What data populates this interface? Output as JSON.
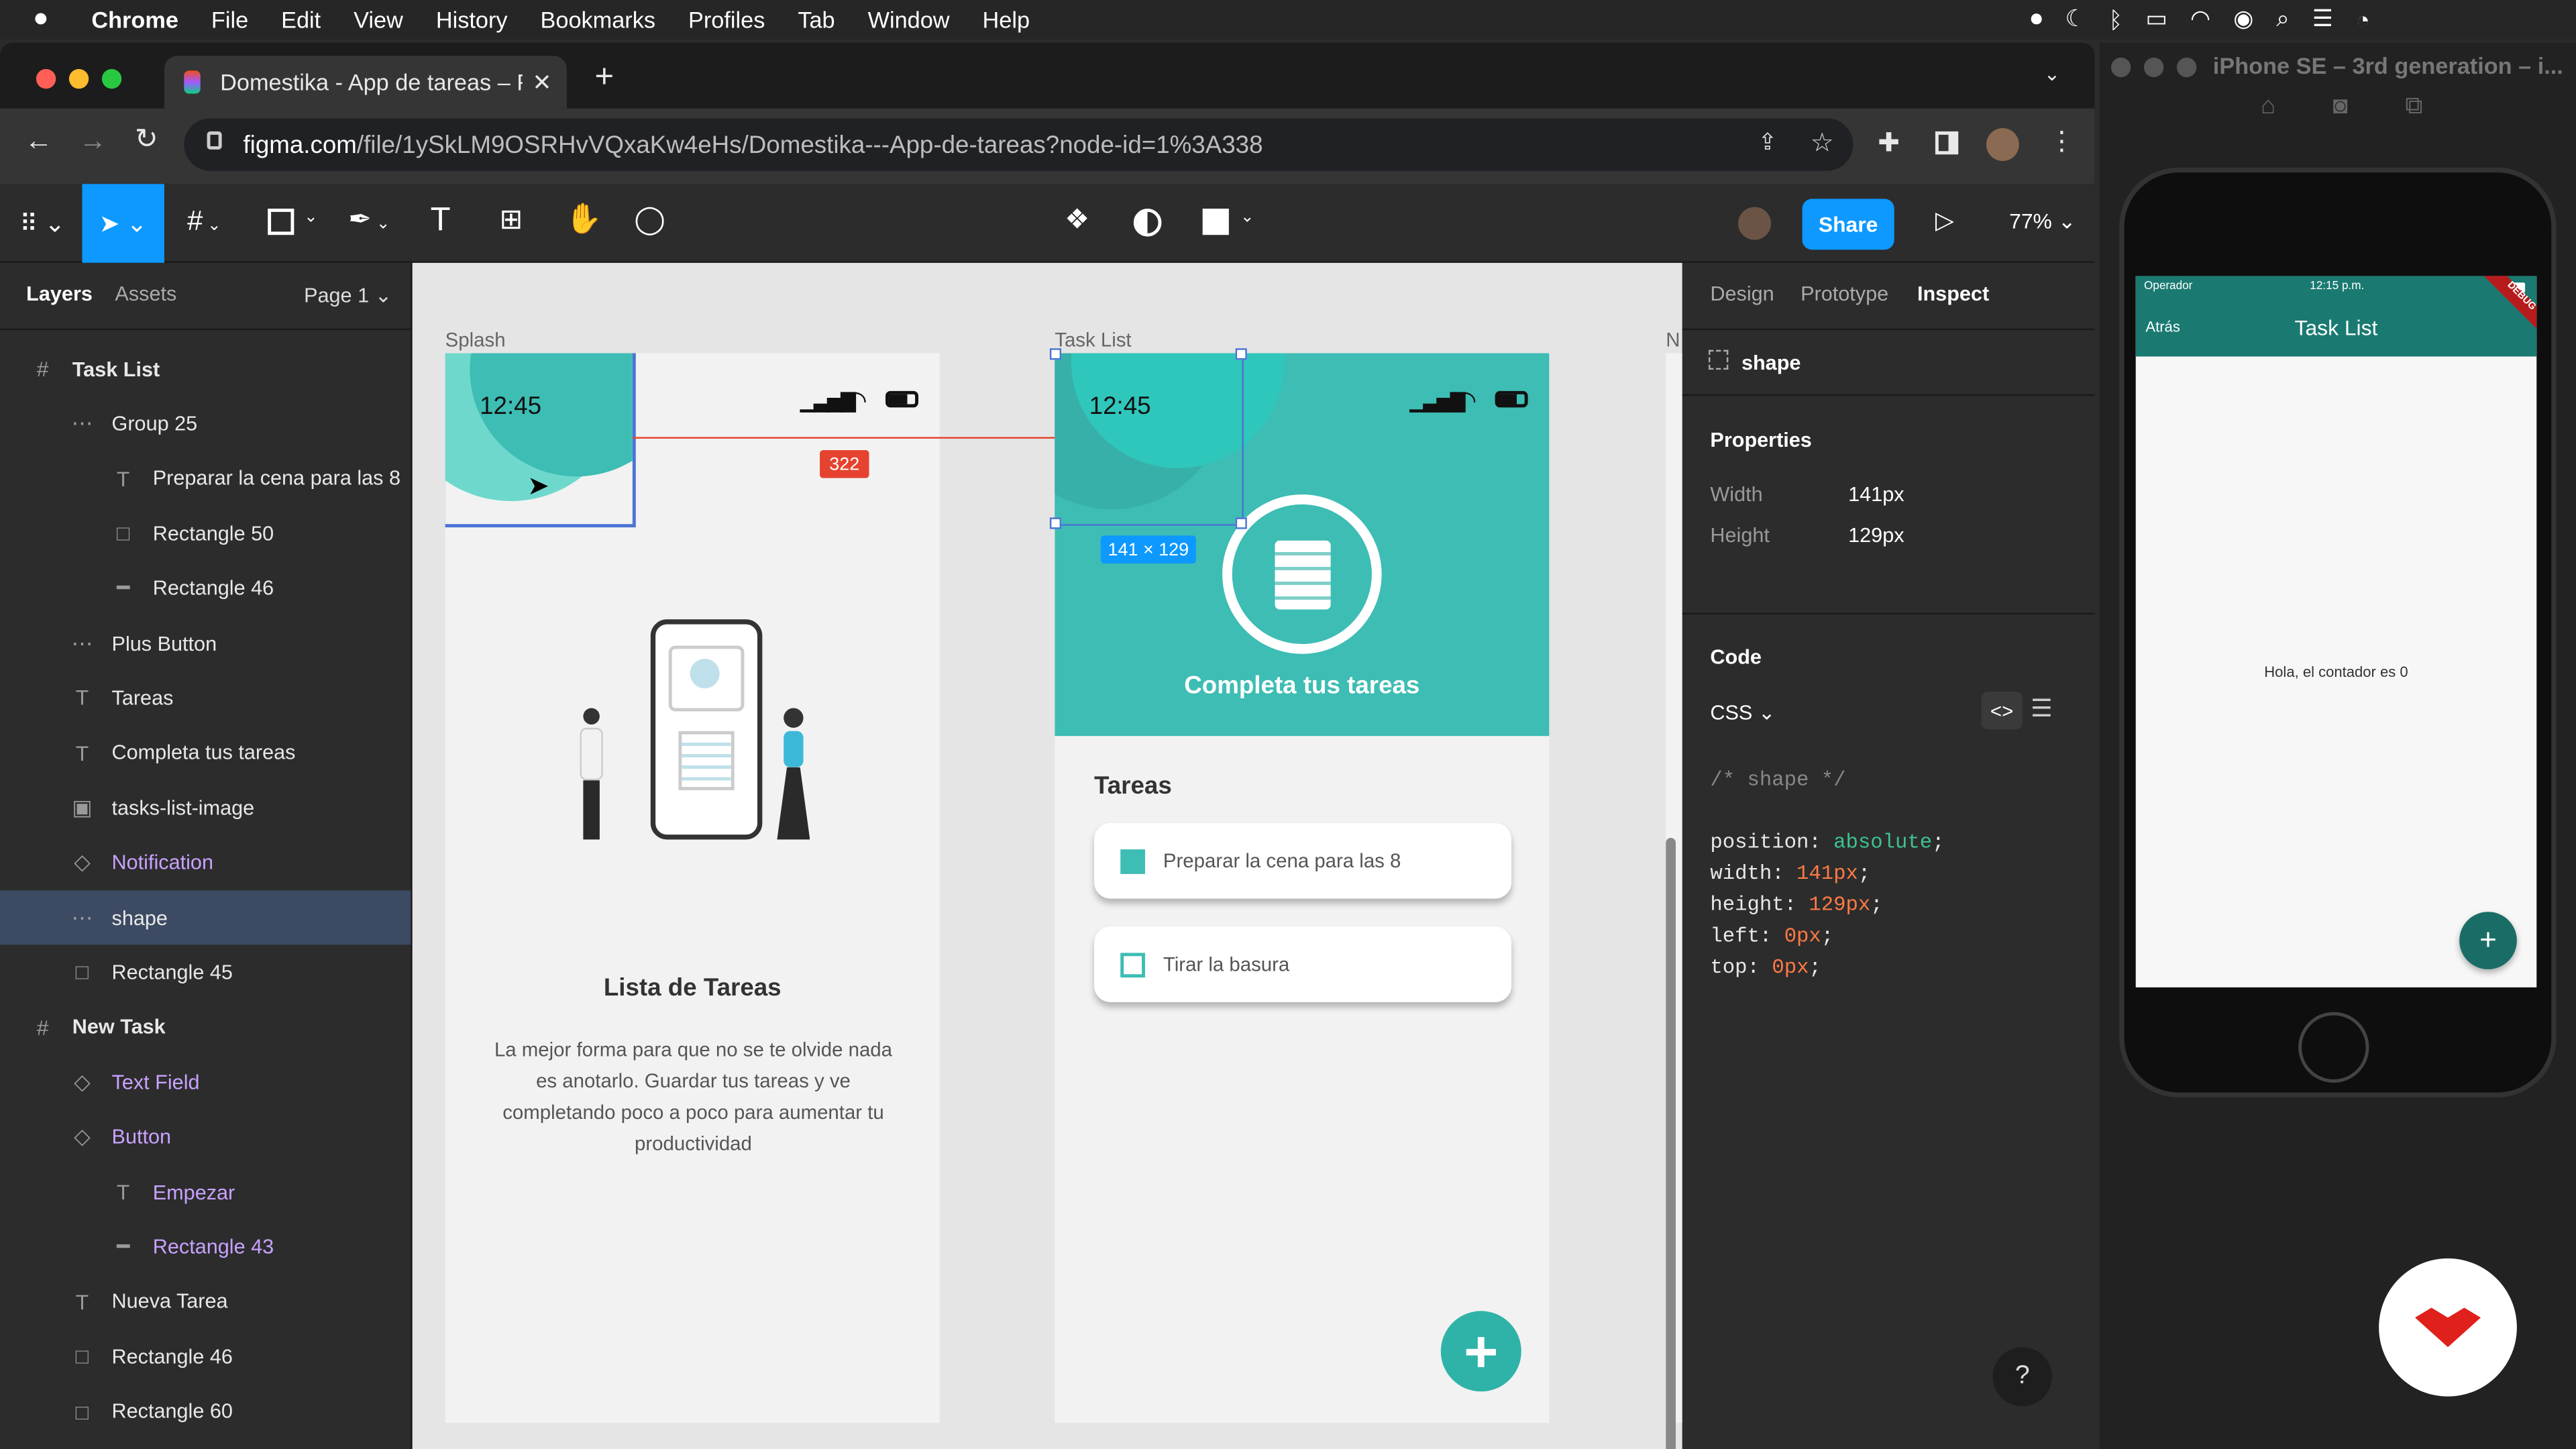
{
  "menubar": {
    "app": "Chrome",
    "items": [
      "File",
      "Edit",
      "View",
      "History",
      "Bookmarks",
      "Profiles",
      "Tab",
      "Window",
      "Help"
    ]
  },
  "browser": {
    "tab_title": "Domestika - App de tareas – Fi",
    "url_host": "figma.com",
    "url_path": "/file/1ySkLM9OSRHvVQxaKw4eHs/Domestika---App-de-tareas?node-id=1%3A338"
  },
  "figma_toolbar": {
    "share_label": "Share",
    "zoom": "77%"
  },
  "layers_panel": {
    "tabs": [
      "Layers",
      "Assets"
    ],
    "page": "Page 1",
    "items": [
      {
        "label": "Task List",
        "icon": "frame-icon"
      },
      {
        "label": "Group 25",
        "icon": "group-icon"
      },
      {
        "label": "Preparar la cena para las 8",
        "icon": "text-icon"
      },
      {
        "label": "Rectangle 50",
        "icon": "rect-icon"
      },
      {
        "label": "Rectangle 46",
        "icon": "line-icon"
      },
      {
        "label": "Plus Button",
        "icon": "group-icon"
      },
      {
        "label": "Tareas",
        "icon": "text-icon"
      },
      {
        "label": "Completa tus tareas",
        "icon": "text-icon"
      },
      {
        "label": "tasks-list-image",
        "icon": "image-icon"
      },
      {
        "label": "Notification",
        "icon": "component-icon"
      },
      {
        "label": "shape",
        "icon": "group-icon"
      },
      {
        "label": "Rectangle 45",
        "icon": "rect-icon"
      },
      {
        "label": "New Task",
        "icon": "frame-icon"
      },
      {
        "label": "Text Field",
        "icon": "component-icon"
      },
      {
        "label": "Button",
        "icon": "component-icon"
      },
      {
        "label": "Empezar",
        "icon": "text-icon"
      },
      {
        "label": "Rectangle 43",
        "icon": "line-icon"
      },
      {
        "label": "Nueva Tarea",
        "icon": "text-icon"
      },
      {
        "label": "Rectangle 46",
        "icon": "rect-icon"
      },
      {
        "label": "Rectangle 60",
        "icon": "rect-icon"
      }
    ]
  },
  "canvas": {
    "frame_splash_label": "Splash",
    "frame_tasklist_label": "Task List",
    "frame_next_label": "N",
    "status_time": "12:45",
    "distance_badge": "322",
    "size_badge": "141 × 129",
    "splash_title": "Lista de Tareas",
    "splash_desc": "La mejor forma para que no se te olvide nada es anotarlo. Guardar tus tareas y ve completando poco a poco para aumentar tu productividad",
    "header_title": "Completa tus tareas",
    "tasks_heading": "Tareas",
    "task1": "Preparar la cena para las 8",
    "task2": "Tirar la basura"
  },
  "right_panel": {
    "tabs": [
      "Design",
      "Prototype",
      "Inspect"
    ],
    "selection": "shape",
    "properties_title": "Properties",
    "width_label": "Width",
    "width_value": "141px",
    "height_label": "Height",
    "height_value": "129px",
    "code_title": "Code",
    "code_lang": "CSS",
    "code_comment": "/* shape */",
    "code_lines": [
      {
        "prop": "position",
        "value": "absolute"
      },
      {
        "prop": "width",
        "value": "141px"
      },
      {
        "prop": "height",
        "value": "129px"
      },
      {
        "prop": "left",
        "value": "0px"
      },
      {
        "prop": "top",
        "value": "0px"
      }
    ]
  },
  "simulator": {
    "title": "iPhone SE – 3rd generation – i...",
    "carrier": "Operador",
    "time": "12:15 p.m.",
    "back_label": "Atrás",
    "app_title": "Task List",
    "debug_label": "DEBUG",
    "body_text": "Hola, el contador es 0"
  },
  "colors": {
    "teal": "#3dbdb4",
    "figma_blue": "#0d99ff",
    "selection_blue": "#4a74d4",
    "measure_red": "#e5432f"
  }
}
